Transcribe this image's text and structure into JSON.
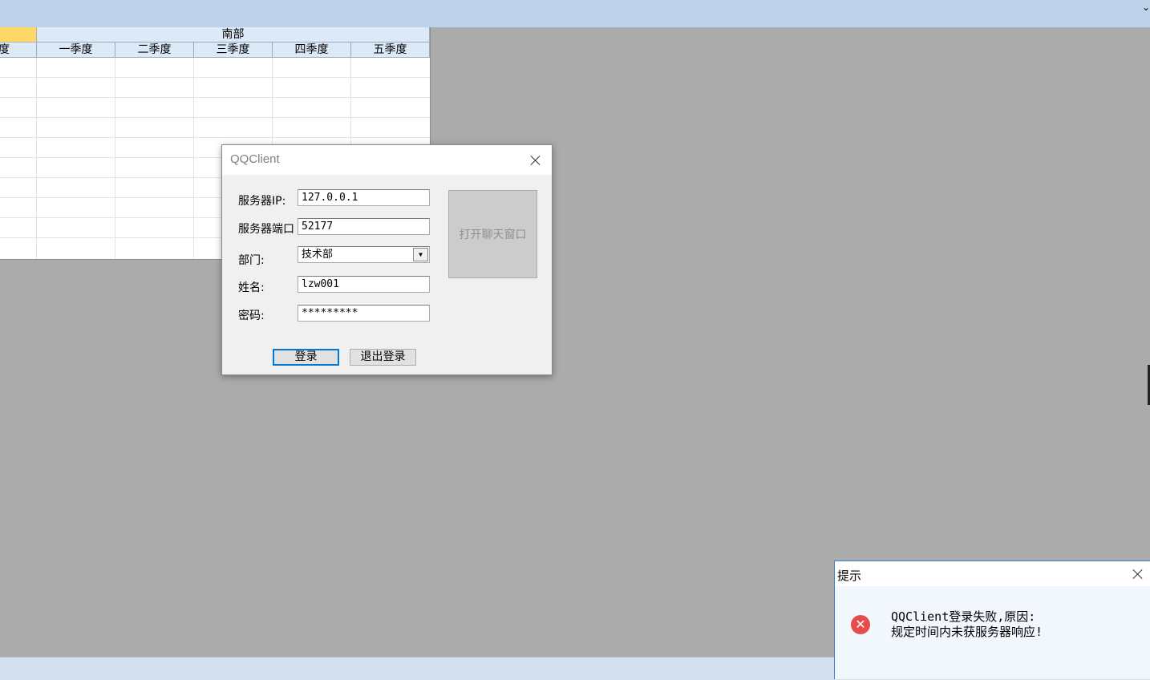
{
  "sheet": {
    "left_header_partial": "度",
    "group_header": "南部",
    "columns": [
      "一季度",
      "二季度",
      "三季度",
      "四季度",
      "五季度"
    ]
  },
  "dialog": {
    "title": "QQClient",
    "labels": {
      "server_ip": "服务器IP:",
      "server_port": "服务器端口",
      "department": "部门:",
      "name": "姓名:",
      "password": "密码:"
    },
    "values": {
      "server_ip": "127.0.0.1",
      "server_port": "52177",
      "department": "技术部",
      "name": "lzw001",
      "password": "*********"
    },
    "open_chat_button": "打开聊天窗口",
    "login_button": "登录",
    "logout_button": "退出登录"
  },
  "msgbox": {
    "title": "提示",
    "line1": "QQClient登录失败,原因:",
    "line2": "规定时间内未获服务器响应!"
  }
}
